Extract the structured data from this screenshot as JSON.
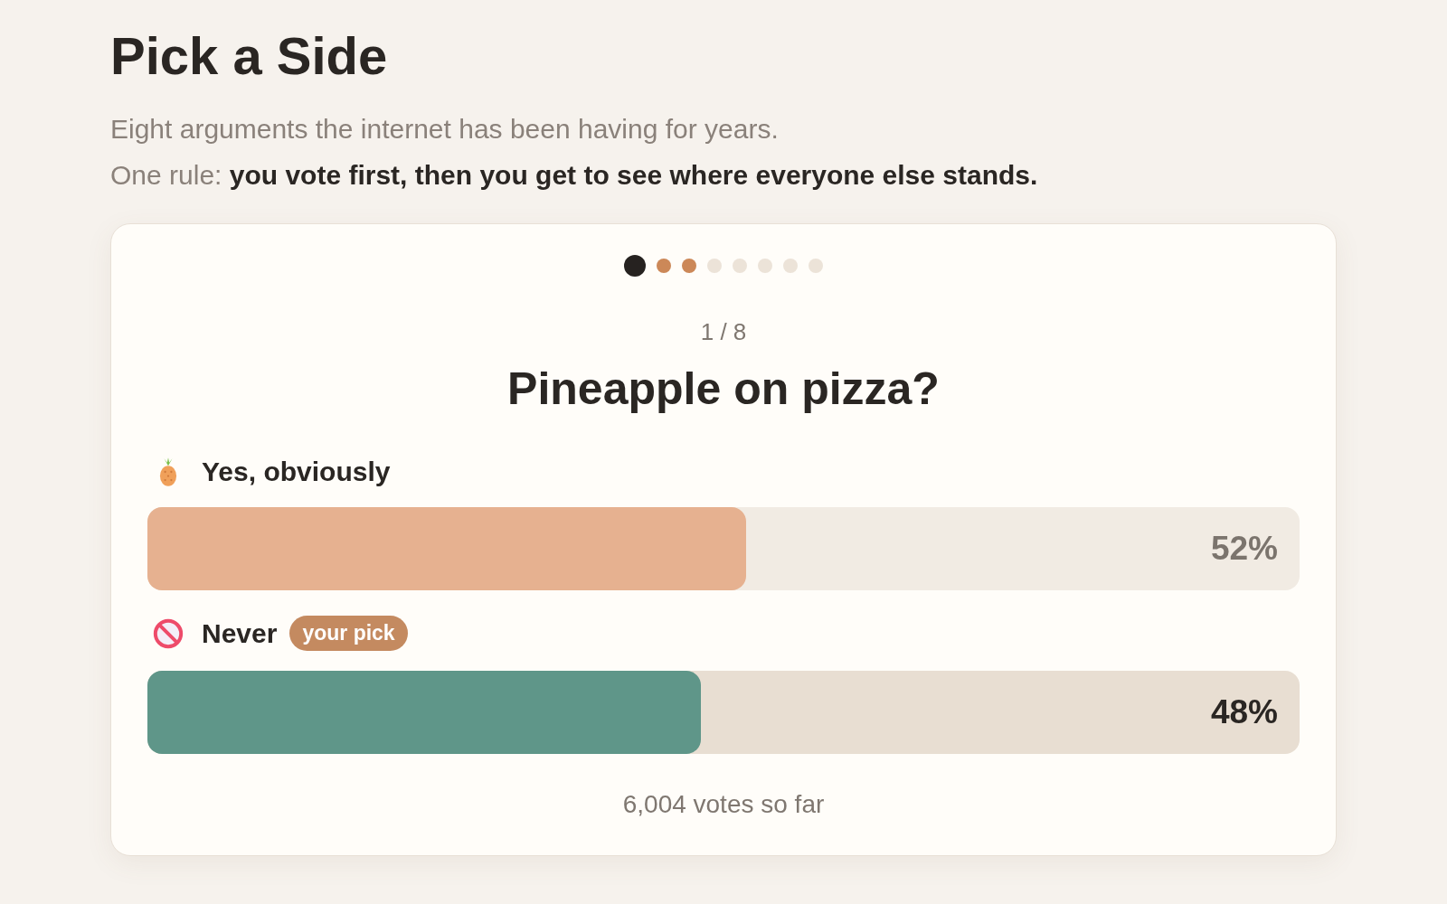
{
  "title": "Pick a Side",
  "intro": [
    "Eight arguments the internet has been having for years.",
    "One rule: **you vote first, then you get to see where everyone else stands.**"
  ],
  "progress_dots": [
    {
      "selected": true,
      "answered": false
    },
    {
      "selected": false,
      "answered": true
    },
    {
      "selected": false,
      "answered": true
    },
    {
      "selected": false,
      "answered": false
    },
    {
      "selected": false,
      "answered": false
    },
    {
      "selected": false,
      "answered": false
    },
    {
      "selected": false,
      "answered": false
    },
    {
      "selected": false,
      "answered": false
    }
  ],
  "counter": "1 / 8",
  "question": "Pineapple on pizza?",
  "options": [
    {
      "kind": "pineapple",
      "label": "Yes, obviously",
      "selected": false,
      "level": 0.52,
      "percent": "52%",
      "color": "#e6b190"
    },
    {
      "kind": "prohibited",
      "label": "Never",
      "selected": true,
      "badge": "your pick",
      "level": 0.48,
      "percent": "48%",
      "color": "#5f9689"
    }
  ],
  "votes": "6,004 votes so far"
}
